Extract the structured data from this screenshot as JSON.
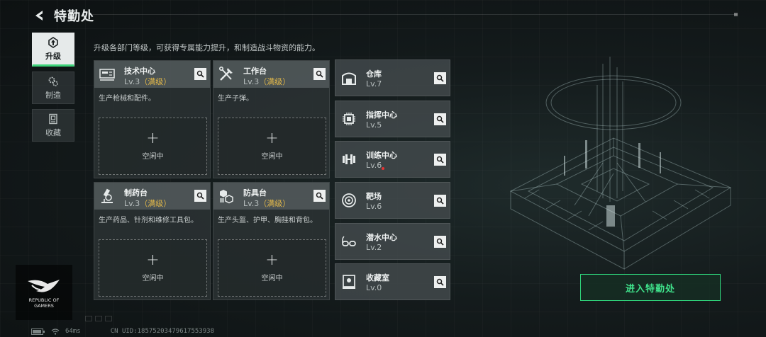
{
  "header": {
    "title": "特勤处"
  },
  "nav": [
    {
      "label": "升级",
      "icon": "upgrade-icon",
      "active": true
    },
    {
      "label": "制造",
      "icon": "craft-gear-icon",
      "active": false
    },
    {
      "label": "收藏",
      "icon": "collection-icon",
      "active": false
    }
  ],
  "description": "升级各部门等级，可获得专属能力提升，和制造战斗物资的能力。",
  "big_cards": [
    {
      "name": "技术中心",
      "level": "Lv.3",
      "status": "（满级）",
      "desc": "生产枪械和配件。",
      "slot_label": "空闲中",
      "icon": "tech-center-icon"
    },
    {
      "name": "工作台",
      "level": "Lv.3",
      "status": "（满级）",
      "desc": "生产子弹。",
      "slot_label": "空闲中",
      "icon": "workbench-tools-icon"
    },
    {
      "name": "制药台",
      "level": "Lv.3",
      "status": "（满级）",
      "desc": "生产药品、针剂和维修工具包。",
      "slot_label": "空闲中",
      "icon": "microscope-icon"
    },
    {
      "name": "防具台",
      "level": "Lv.3",
      "status": "（满级）",
      "desc": "生产头盔、护甲、胸挂和背包。",
      "slot_label": "空闲中",
      "icon": "armor-cubes-icon"
    }
  ],
  "small_cards": [
    {
      "name": "仓库",
      "level": "Lv.7",
      "icon": "warehouse-icon"
    },
    {
      "name": "指挥中心",
      "level": "Lv.5",
      "icon": "chip-icon"
    },
    {
      "name": "训练中心",
      "level": "Lv.6",
      "icon": "dumbbell-icon"
    },
    {
      "name": "靶场",
      "level": "Lv.6",
      "icon": "target-icon"
    },
    {
      "name": "潜水中心",
      "level": "Lv.2",
      "icon": "diving-mask-icon"
    },
    {
      "name": "收藏室",
      "level": "Lv.0",
      "icon": "display-case-icon"
    }
  ],
  "enter_button": "进入特勤处",
  "rog": {
    "line1": "REPUBLIC OF",
    "line2": "GAMERS"
  },
  "footer": {
    "ping": "64ms",
    "uid": "CN UID:18575203479617553938"
  },
  "colors": {
    "accent_green": "#2fd67c",
    "maxed_gold": "#e2b84a",
    "notification_red": "#e53535"
  }
}
